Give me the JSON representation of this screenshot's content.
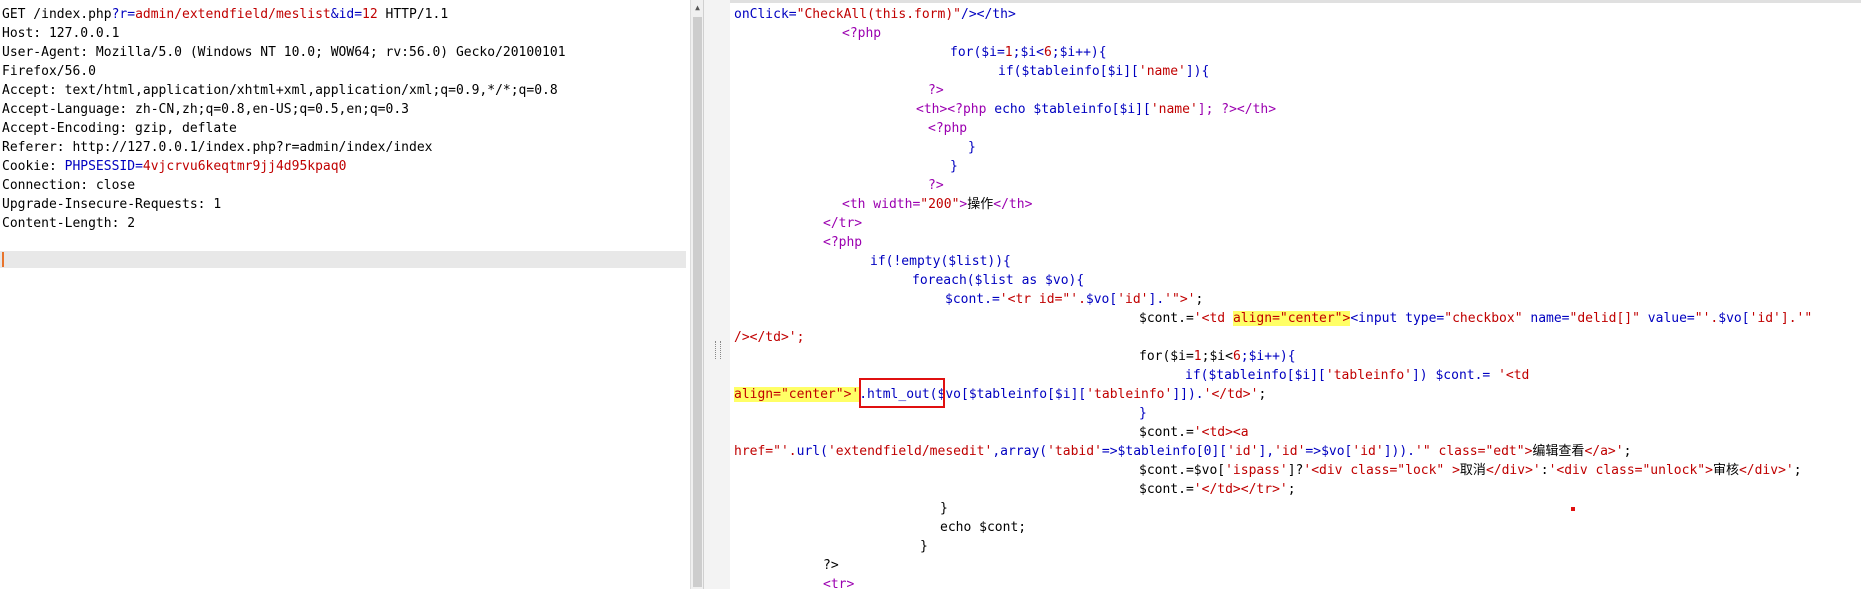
{
  "request": {
    "lines": [
      "GET /index.php?r=admin/extendfield/meslist&id=12 HTTP/1.1",
      "Host: 127.0.0.1",
      "User-Agent: Mozilla/5.0 (Windows NT 10.0; WOW64; rv:56.0) Gecko/20100101",
      "Firefox/56.0",
      "Accept: text/html,application/xhtml+xml,application/xml;q=0.9,*/*;q=0.8",
      "Accept-Language: zh-CN,zh;q=0.8,en-US;q=0.5,en;q=0.3",
      "Accept-Encoding: gzip, deflate",
      "Referer: http://127.0.0.1/index.php?r=admin/index/index",
      "Cookie: PHPSESSID=4vjcrvu6keqtmr9jj4d95kpaq0",
      "Connection: close",
      "Upgrade-Insecure-Requests: 1",
      "Content-Length: 2"
    ],
    "request_line": {
      "method": "GET /index.php",
      "q": "?",
      "r_key": "r",
      "eq1": "=",
      "r_val": "admin/extendfield/meslist",
      "amp": "&",
      "id_key": "id",
      "eq2": "=",
      "id_val": "12",
      "proto": " HTTP/1.1"
    },
    "cookie": {
      "prefix": "Cookie: ",
      "name": "PHPSESSID",
      "eq": "=",
      "value": "4vjcrvu6keqtmr9jj4d95kpaq0"
    }
  },
  "code": {
    "l1_a": "onClick=",
    "l1_b": "\"CheckAll(this.form)\"",
    "l1_c": "/></th>",
    "l2": "<?php",
    "l3_a": "for($i=",
    "l3_b": "1",
    "l3_c": ";$i<",
    "l3_d": "6",
    "l3_e": ";$i++){",
    "l4_a": "if($tableinfo[$i][",
    "l4_b": "'name'",
    "l4_c": "]){",
    "l5": "?>",
    "l6_a": "<th><?php",
    "l6_b": " echo $tableinfo[$i][",
    "l6_c": "'name'",
    "l6_d": "]; ?></th>",
    "l7": "<?php",
    "l8": "}",
    "l9": "}",
    "l10": "?>",
    "l11_a": "<th width=",
    "l11_b": "\"200\"",
    "l11_c": ">",
    "l11_d": "操作",
    "l11_e": "</th>",
    "l12": "</tr>",
    "l13": "<?php",
    "l14_a": "if(!empty($list)){",
    "l15_a": "foreach($list as $vo){",
    "l16_a": "$cont.=",
    "l16_b": "'<tr id=\"'.",
    "l16_c": "$vo[",
    "l16_d": "'id'",
    "l16_e": "].",
    "l16_f": "'\">'",
    "l16_g": ";",
    "l17_a": "$cont.=",
    "l17_b": "'<td ",
    "l17_c": "align=\"center\">",
    "l17_d": "<input type=",
    "l17_e": "\"checkbox\"",
    "l17_f": " name=",
    "l17_g": "\"delid[]\"",
    "l17_h": " value=",
    "l17_i": "\"'.",
    "l17_j": "$vo[",
    "l17_k": "'id'",
    "l17_l": "].'\"",
    "l18": "/></td>';",
    "l19_a": "for($i=",
    "l19_b": "1",
    "l19_c": ";$i<",
    "l19_d": "6",
    "l19_e": ";$i++){",
    "l20_a": "if($tableinfo[$i][",
    "l20_b": "'tableinfo'",
    "l20_c": "]) $cont.= ",
    "l20_d": "'<td",
    "l21_a": "align=\"center\">'",
    "l21_b": ".html_out(",
    "l21_c": "$vo[$tableinfo[$i][",
    "l21_d": "'tableinfo'",
    "l21_e": "]]).",
    "l21_f": "'</td>'",
    "l21_g": ";",
    "l22": "}",
    "l23_a": "$cont.=",
    "l23_b": "'<td><a",
    "l24_a": "href=\"'.",
    "l24_b": "url(",
    "l24_c": "'extendfield/mesedit'",
    "l24_d": ",array(",
    "l24_e": "'tabid'",
    "l24_f": "=>$tableinfo[0][",
    "l24_g": "'id'",
    "l24_h": "],",
    "l24_i": "'id'",
    "l24_j": "=>$vo[",
    "l24_k": "'id'",
    "l24_l": "])).",
    "l24_m": "'\" class=\"edt\">",
    "l24_n": "编辑查看",
    "l24_o": "</a>'",
    "l24_p": ";",
    "l25_a": "$cont.=$vo[",
    "l25_b": "'ispass'",
    "l25_c": "]?",
    "l25_d": "'<div class=\"lock\" >",
    "l25_e": "取消",
    "l25_f": "</div>'",
    "l25_g": ":",
    "l25_h": "'<div class=\"unlock\">",
    "l25_i": "审核",
    "l25_j": "</div>'",
    "l25_k": ";",
    "l26_a": "$cont.=",
    "l26_b": "'</td></tr>'",
    "l26_c": ";",
    "l27": "}",
    "l28": "echo $cont;",
    "l29": "}",
    "l30": "?>",
    "l31": "<tr>"
  },
  "colors": {
    "highlight_box": "#e01010",
    "attr_highlight": "#ffff66",
    "keyword_blue": "#0000c0",
    "string_red": "#c00000",
    "php_purple": "#9b00b0"
  }
}
